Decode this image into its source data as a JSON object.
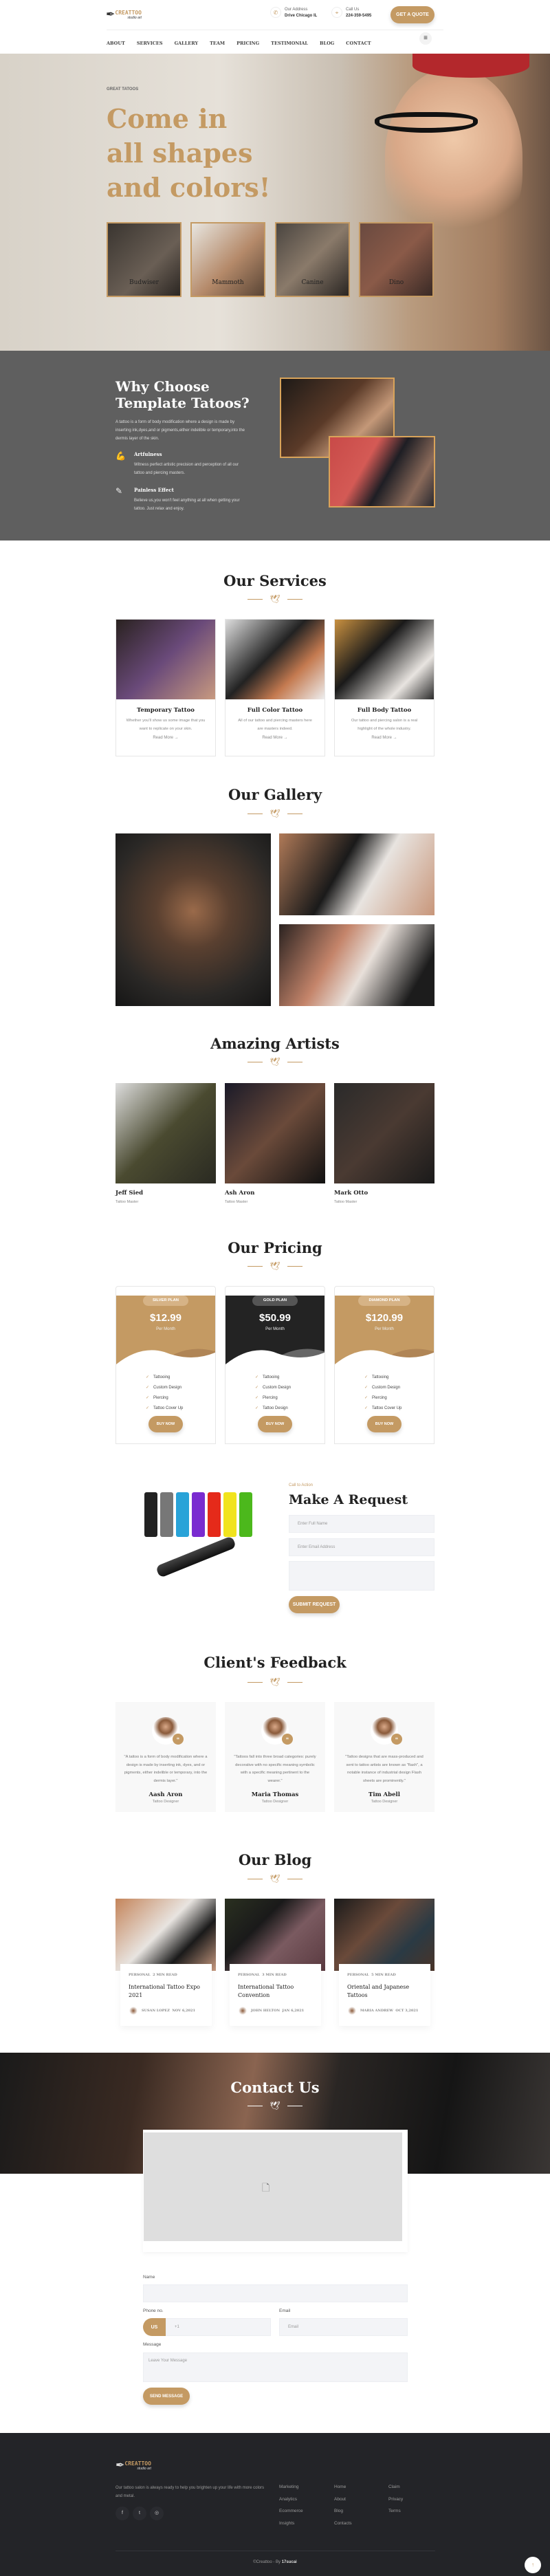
{
  "header": {
    "brand": "CREATTOO",
    "brand_tagline": "studio art",
    "address_label": "Our Address",
    "address_value": "Drive Chicago IL",
    "call_label": "Call Us",
    "call_value": "224-359-5495",
    "quote_button": "GET A QUOTE",
    "nav": [
      "ABOUT",
      "SERVICES",
      "GALLERY",
      "TEAM",
      "PRICING",
      "TESTIMONIAL",
      "BLOG",
      "CONTACT"
    ]
  },
  "hero": {
    "eyebrow": "GREAT TATOOS",
    "title": "Come in all shapes and colors!",
    "thumbs": [
      "Budwiser",
      "Mammoth",
      "Canine",
      "Dino"
    ]
  },
  "why": {
    "title": "Why Choose Template Tatoos?",
    "text": "A tattoo is a form of body modification where a design is made by inserting ink,dyes,and or pigments,either indelible or temporary,into the dermis layer of the skin.",
    "features": [
      {
        "title": "Artfulness",
        "text": "Witness perfect artistic precision and perception of all our tattoo and piercing masters."
      },
      {
        "title": "Painless Effect",
        "text": "Believe us,you won't feel anything at all when getting your tattoo. Just relax and enjoy."
      }
    ]
  },
  "services": {
    "title": "Our Services",
    "read_more": "Read More",
    "items": [
      {
        "title": "Temporary Tattoo",
        "text": "Whether you'll show us some image that you want to replicate on your skin."
      },
      {
        "title": "Full Color Tattoo",
        "text": "All of our tattoo and piercing masters here are masters indeed."
      },
      {
        "title": "Full Body Tattoo",
        "text": "Our tattoo and piercing salon is a real highlight of the whole industry."
      }
    ]
  },
  "gallery": {
    "title": "Our Gallery"
  },
  "artists": {
    "title": "Amazing Artists",
    "items": [
      {
        "name": "Jeff Sied",
        "role": "Tattoo Master"
      },
      {
        "name": "Ash Aron",
        "role": "Tattoo Master"
      },
      {
        "name": "Mark Otto",
        "role": "Tattoo Master"
      }
    ]
  },
  "pricing": {
    "title": "Our Pricing",
    "buy": "BUY NOW",
    "plans": [
      {
        "name": "SILVER PLAN",
        "price": "$12.99",
        "period": "Per Month",
        "features": [
          "Tattooing",
          "Custom Design",
          "Piercing",
          "Tattoo Cover Up"
        ]
      },
      {
        "name": "GOLD PLAN",
        "price": "$50.99",
        "period": "Per Month",
        "features": [
          "Tattooing",
          "Custom Design",
          "Piercing",
          "Tattoo Design"
        ]
      },
      {
        "name": "DIAMOND PLAN",
        "price": "$120.99",
        "period": "Per Month",
        "features": [
          "Tattooing",
          "Custom Design",
          "Piercing",
          "Tattoo Cover Up"
        ]
      }
    ]
  },
  "request": {
    "eyebrow": "Call to Action",
    "title": "Make A Request",
    "name_placeholder": "Enter Full Name",
    "email_placeholder": "Enter Email Address",
    "submit": "SUBMIT REQUEST"
  },
  "feedback": {
    "title": "Client's Feedback",
    "items": [
      {
        "quote": "\"A tattoo is a form of body modification where a design is made by inserting ink, dyes, and or pigments, either indelible or temporary, into the dermis layer.\"",
        "name": "Aash Aron",
        "role": "Tattoo Designer"
      },
      {
        "quote": "\"Tattoos fall into three broad categories: purely decorative with no specific meaning symbolic with a specific meaning pertinent to the wearer.\"",
        "name": "Maria Thomas",
        "role": "Tattoo Designer"
      },
      {
        "quote": "\"Tattoo designs that are mass-produced and sent to tattoo artists are known as \"flash\", a notable instance of industrial design Flash sheets are prominently.\"",
        "name": "Tim Abell",
        "role": "Tattoo Designer"
      }
    ]
  },
  "blog": {
    "title": "Our Blog",
    "items": [
      {
        "category": "PERSONAL",
        "read": "2 MIN READ",
        "title": "International Tattoo Expo 2021",
        "author": "SUSAN LOPEZ",
        "date": "NOV 6,2021"
      },
      {
        "category": "PERSONAL",
        "read": "3 MIN READ",
        "title": "International Tattoo Convention",
        "author": "JOHN HELTON",
        "date": "JAN 6,2021"
      },
      {
        "category": "PERSONAL",
        "read": "5 MIN READ",
        "title": "Oriental and Japanese Tattoos",
        "author": "MARIA ANDREW",
        "date": "OCT 3,2021"
      }
    ]
  },
  "contact": {
    "title": "Contact Us",
    "name_label": "Name",
    "phone_label": "Phone no.",
    "country": "US",
    "phone_placeholder": "+1",
    "email_label": "Email",
    "email_placeholder": "Email",
    "message_label": "Message",
    "message_placeholder": "Leave Your Message",
    "send": "SEND MESSAGE"
  },
  "footer": {
    "text": "Our tattoo salon is always ready to help you brighten up your life with more colors and metal.",
    "col1": [
      "Marketing",
      "Analytics",
      "Ecommerce",
      "Insights"
    ],
    "col2": [
      "Home",
      "About",
      "Blog",
      "Contacts"
    ],
    "col3": [
      "Claim",
      "Privacy",
      "Terms"
    ],
    "copyright": "©Creattoo - By ",
    "copyright_brand": "17sucai"
  },
  "colors": {
    "accent": "#c49a63",
    "dark": "#232428",
    "gray_band": "#5f5f5f"
  }
}
